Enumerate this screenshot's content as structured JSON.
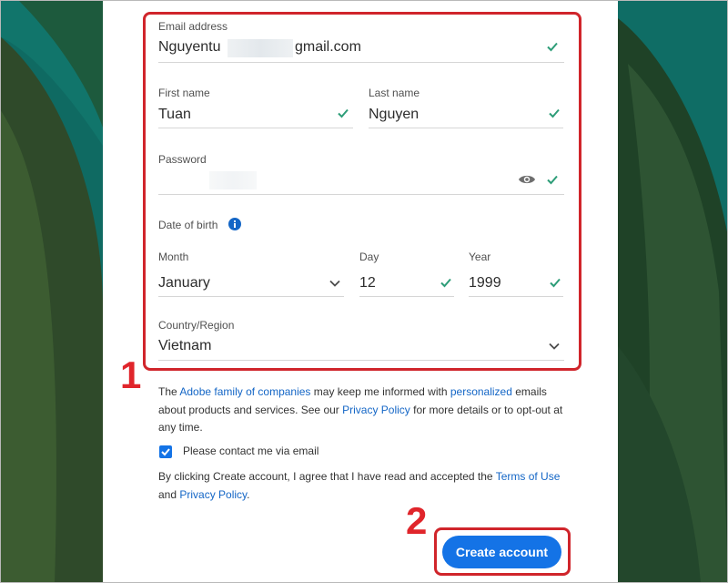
{
  "form": {
    "email": {
      "label": "Email address",
      "value": "Nguyentu",
      "value_suffix": "gmail.com"
    },
    "first_name": {
      "label": "First name",
      "value": "Tuan"
    },
    "last_name": {
      "label": "Last name",
      "value": "Nguyen"
    },
    "password": {
      "label": "Password"
    },
    "dob": {
      "label": "Date of birth",
      "month": {
        "label": "Month",
        "value": "January"
      },
      "day": {
        "label": "Day",
        "value": "12"
      },
      "year": {
        "label": "Year",
        "value": "1999"
      }
    },
    "country": {
      "label": "Country/Region",
      "value": "Vietnam"
    }
  },
  "legal": {
    "p1_a": "The ",
    "p1_link1": "Adobe family of companies",
    "p1_b": " may keep me informed with ",
    "p1_link2": "personalized",
    "p1_c": " emails about products and services. See our ",
    "p1_link3": "Privacy Policy",
    "p1_d": " for more details or to opt-out at any time.",
    "checkbox_label": "Please contact me via email",
    "p2_a": "By clicking Create account, I agree that I have read and accepted the ",
    "p2_link1": "Terms of Use",
    "p2_b": " and ",
    "p2_link2": "Privacy Policy",
    "p2_c": "."
  },
  "actions": {
    "create_account": "Create account"
  },
  "annotations": {
    "step1": "1",
    "step2": "2"
  },
  "colors": {
    "accent": "#1473e6",
    "check": "#2d9d78",
    "annotation": "#e0252b"
  }
}
